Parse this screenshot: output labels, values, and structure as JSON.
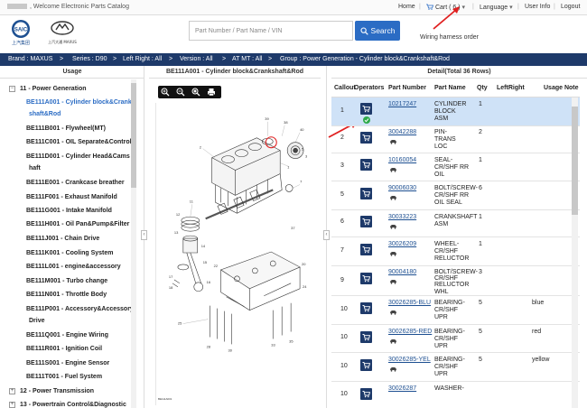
{
  "topbar": {
    "welcome": ", Welcome Electronic Parts Catalog",
    "home": "Home",
    "cart": "Cart ( 6 )",
    "language": "Language",
    "user_info": "User Info",
    "logout": "Logout"
  },
  "header": {
    "logo1_caption": "上汽集团",
    "logo2_caption": "上汽大通 MAXUS",
    "search_placeholder": "Part Number / Part Name / VIN",
    "search_button": "Search",
    "wiring_harness": "Wiring harness order"
  },
  "breadcrumb": {
    "brand": "Brand : MAXUS",
    "series": "Series : D90",
    "left_right": "Left Right : All",
    "version": "Version : All",
    "at_mt": "AT MT : All",
    "group": "Group : Power Generation - Cylinder block&Crankshaft&Rod"
  },
  "columns": {
    "usage": "Usage",
    "diagram": "BE111A001 - Cylinder block&Crankshaft&Rod",
    "detail": "Detail(Total 36 Rows)"
  },
  "tree": [
    {
      "label": "11 - Power Generation",
      "level": 0,
      "expanded": true
    },
    {
      "label": "BE111A001 - Cylinder block&Crank",
      "label2": "shaft&Rod",
      "level": 1,
      "selected": true
    },
    {
      "label": "BE111B001 - Flywheel(MT)",
      "level": 1
    },
    {
      "label": "BE111C001 - OIL Separate&Control",
      "level": 1
    },
    {
      "label": "BE111D001 - Cylinder Head&Cams",
      "label2": "haft",
      "level": 1
    },
    {
      "label": "BE111E001 - Crankcase breather",
      "level": 1
    },
    {
      "label": "BE111F001 - Exhaust Manifold",
      "level": 1
    },
    {
      "label": "BE111G001 - Intake Manifold",
      "level": 1
    },
    {
      "label": "BE111H001 - Oil Pan&Pump&Filter",
      "level": 1
    },
    {
      "label": "BE111J001 - Chain Drive",
      "level": 1
    },
    {
      "label": "BE111K001 - Cooling System",
      "level": 1
    },
    {
      "label": "BE111L001 - engine&accessory",
      "level": 1
    },
    {
      "label": "BE111M001 - Turbo change",
      "level": 1
    },
    {
      "label": "BE111N001 - Throttle Body",
      "level": 1
    },
    {
      "label": "BE111P001 - Accessory&Accessory",
      "label2": "Drive",
      "level": 1
    },
    {
      "label": "BE111Q001 - Engine Wiring",
      "level": 1
    },
    {
      "label": "BE111R001 - Ignition Coil",
      "level": 1
    },
    {
      "label": "BE111S001 - Engine Sensor",
      "level": 1
    },
    {
      "label": "BE111T001 - Fuel System",
      "level": 1
    },
    {
      "label": "12 - Power Transmission",
      "level": 0,
      "expanded": false
    },
    {
      "label": "13 - Powertrain Control&Diagnostic",
      "level": 0,
      "expanded": false
    }
  ],
  "table": {
    "headers": [
      "Callout",
      "Operators",
      "Part Number",
      "Part Name",
      "Qty",
      "LeftRight",
      "Usage Note"
    ],
    "rows": [
      {
        "callout": "1",
        "part_number": "10217247",
        "part_name": [
          "CYLINDER",
          "BLOCK",
          "ASM"
        ],
        "qty": "1",
        "leftright": "",
        "note": "",
        "selected": true,
        "in_cart": true
      },
      {
        "callout": "2",
        "part_number": "30042288",
        "part_name": [
          "PIN-",
          "TRANS",
          "LOC"
        ],
        "qty": "2",
        "leftright": "",
        "note": ""
      },
      {
        "callout": "3",
        "part_number": "10160054",
        "part_name": [
          "SEAL-",
          "CR/SHF RR",
          "OIL"
        ],
        "qty": "1",
        "leftright": "",
        "note": ""
      },
      {
        "callout": "5",
        "part_number": "90006030",
        "part_name": [
          "BOLT/SCREW-",
          "CR/SHF RR",
          "OIL SEAL"
        ],
        "qty": "6",
        "leftright": "",
        "note": ""
      },
      {
        "callout": "6",
        "part_number": "30033223",
        "part_name": [
          "CRANKSHAFT",
          "ASM"
        ],
        "qty": "1",
        "leftright": "",
        "note": ""
      },
      {
        "callout": "7",
        "part_number": "30026209",
        "part_name": [
          "WHEEL-",
          "CR/SHF",
          "RELUCTOR"
        ],
        "qty": "1",
        "leftright": "",
        "note": ""
      },
      {
        "callout": "9",
        "part_number": "90004180",
        "part_name": [
          "BOLT/SCREW-",
          "CR/SHF",
          "RELUCTOR",
          "WHL"
        ],
        "qty": "3",
        "leftright": "",
        "note": ""
      },
      {
        "callout": "10",
        "part_number": "30026285-BLU",
        "part_name": [
          "BEARING-",
          "CR/SHF",
          "UPR"
        ],
        "qty": "5",
        "leftright": "",
        "note": "blue"
      },
      {
        "callout": "10",
        "part_number": "30026285-RED",
        "part_name": [
          "BEARING-",
          "CR/SHF",
          "UPR"
        ],
        "qty": "5",
        "leftright": "",
        "note": "red"
      },
      {
        "callout": "10",
        "part_number": "30026285-YEL",
        "part_name": [
          "BEARING-",
          "CR/SHF",
          "UPR"
        ],
        "qty": "5",
        "leftright": "",
        "note": "yellow"
      },
      {
        "callout": "10",
        "part_number": "30026287",
        "part_name": [
          "WASHER-"
        ],
        "qty": "",
        "leftright": "",
        "note": ""
      }
    ]
  },
  "diagram": {
    "callout_numbers": [
      "39",
      "38",
      "40",
      "5",
      "3",
      "1",
      "2",
      "7",
      "11",
      "12",
      "13",
      "14",
      "15",
      "16",
      "17",
      "18",
      "20",
      "22",
      "24",
      "25",
      "28",
      "30",
      "33",
      "35",
      "37"
    ],
    "footer": "BE111A001"
  },
  "colors": {
    "brand_dark": "#1e3a6a",
    "search_blue": "#2b6cc4",
    "link": "#1d4f91",
    "selected_row": "#cfe2f7",
    "arrow": "#e02020"
  }
}
